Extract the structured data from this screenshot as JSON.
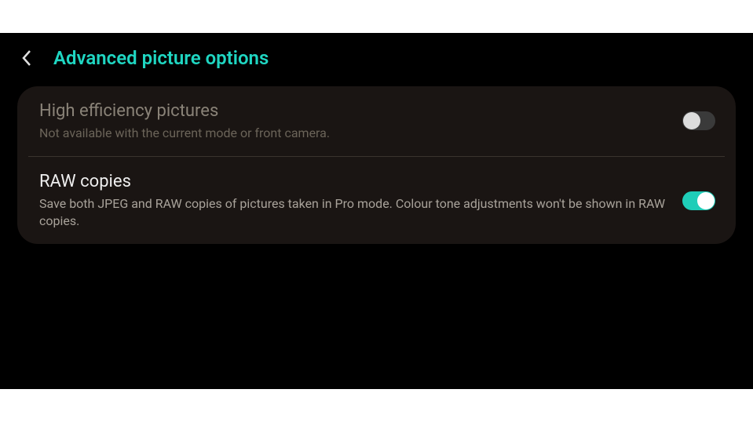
{
  "header": {
    "title": "Advanced picture options"
  },
  "options": [
    {
      "title": "High efficiency pictures",
      "subtitle": "Not available with the current mode or front camera.",
      "enabled": false,
      "toggled": false
    },
    {
      "title": "RAW copies",
      "subtitle": "Save both JPEG and RAW copies of pictures taken in Pro mode. Colour tone adjustments won't be shown in RAW copies.",
      "enabled": true,
      "toggled": true
    }
  ]
}
